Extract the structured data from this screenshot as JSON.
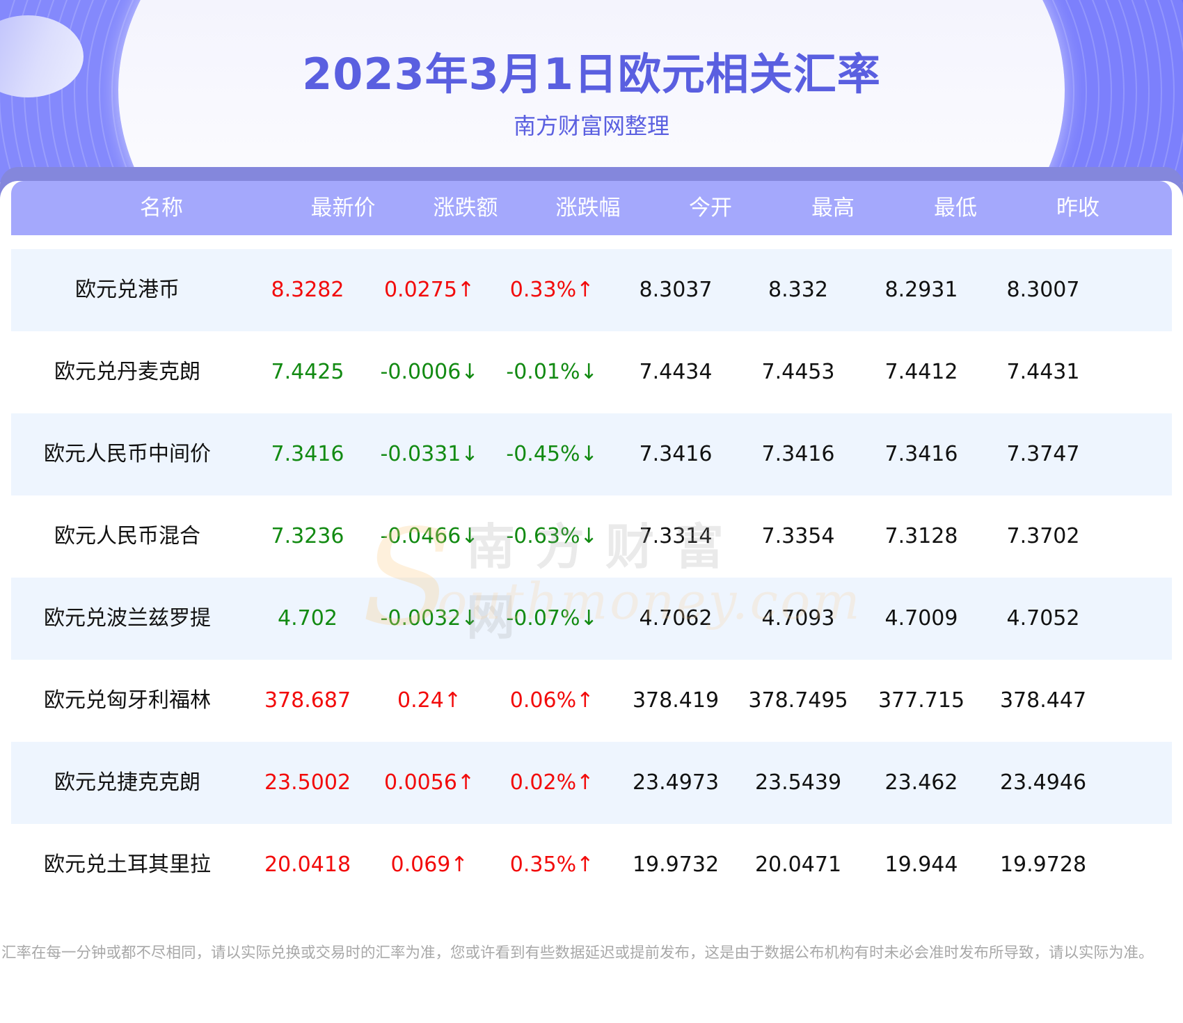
{
  "header": {
    "title": "2023年3月1日欧元相关汇率",
    "subtitle": "南方财富网整理"
  },
  "watermark": {
    "cn": "南方财富网",
    "s_glyph": "S",
    "en": "outhmoney.com"
  },
  "colors": {
    "accent": "#5a5fe0",
    "banner": "#6a6ffc",
    "header_row": "#a4a8fc",
    "strip": "#8487dc",
    "alt_row": "#eef5fe",
    "up": "#f20b0b",
    "down": "#128a12",
    "footer": "#a8a8a8"
  },
  "table": {
    "columns": [
      "名称",
      "最新价",
      "涨跌额",
      "涨跌幅",
      "今开",
      "最高",
      "最低",
      "昨收"
    ],
    "rows": [
      {
        "name": "欧元兑港币",
        "latest": "8.3282",
        "change": "0.0275↑",
        "pct": "0.33%↑",
        "open": "8.3037",
        "high": "8.332",
        "low": "8.2931",
        "prev": "8.3007",
        "trend": "up"
      },
      {
        "name": "欧元兑丹麦克朗",
        "latest": "7.4425",
        "change": "-0.0006↓",
        "pct": "-0.01%↓",
        "open": "7.4434",
        "high": "7.4453",
        "low": "7.4412",
        "prev": "7.4431",
        "trend": "down"
      },
      {
        "name": "欧元人民币中间价",
        "latest": "7.3416",
        "change": "-0.0331↓",
        "pct": "-0.45%↓",
        "open": "7.3416",
        "high": "7.3416",
        "low": "7.3416",
        "prev": "7.3747",
        "trend": "down"
      },
      {
        "name": "欧元人民币混合",
        "latest": "7.3236",
        "change": "-0.0466↓",
        "pct": "-0.63%↓",
        "open": "7.3314",
        "high": "7.3354",
        "low": "7.3128",
        "prev": "7.3702",
        "trend": "down"
      },
      {
        "name": "欧元兑波兰兹罗提",
        "latest": "4.702",
        "change": "-0.0032↓",
        "pct": "-0.07%↓",
        "open": "4.7062",
        "high": "4.7093",
        "low": "4.7009",
        "prev": "4.7052",
        "trend": "down"
      },
      {
        "name": "欧元兑匈牙利福林",
        "latest": "378.687",
        "change": "0.24↑",
        "pct": "0.06%↑",
        "open": "378.419",
        "high": "378.7495",
        "low": "377.715",
        "prev": "378.447",
        "trend": "up"
      },
      {
        "name": "欧元兑捷克克朗",
        "latest": "23.5002",
        "change": "0.0056↑",
        "pct": "0.02%↑",
        "open": "23.4973",
        "high": "23.5439",
        "low": "23.462",
        "prev": "23.4946",
        "trend": "up"
      },
      {
        "name": "欧元兑土耳其里拉",
        "latest": "20.0418",
        "change": "0.069↑",
        "pct": "0.35%↑",
        "open": "19.9732",
        "high": "20.0471",
        "low": "19.944",
        "prev": "19.9728",
        "trend": "up"
      }
    ]
  },
  "footer": {
    "disclaimer": "汇率在每一分钟或都不尽相同，请以实际兑换或交易时的汇率为准，您或许看到有些数据延迟或提前发布，这是由于数据公布机构有时未必会准时发布所导致，请以实际为准。"
  }
}
